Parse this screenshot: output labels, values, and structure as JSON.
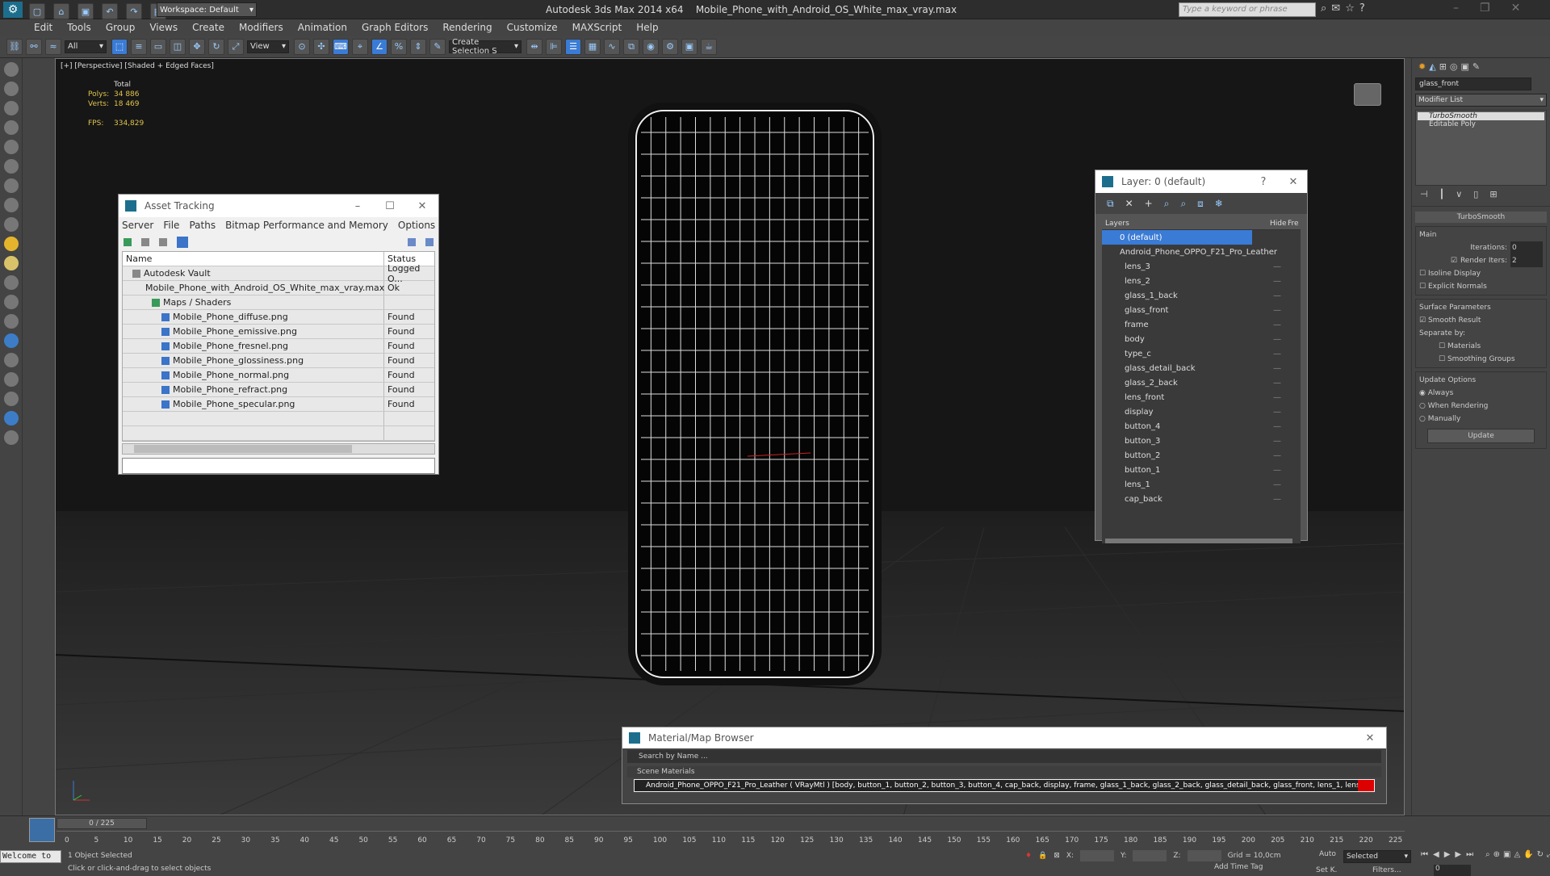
{
  "app": {
    "title": "Autodesk 3ds Max  2014 x64",
    "file": "Mobile_Phone_with_Android_OS_White_max_vray.max",
    "workspace": "Workspace: Default",
    "search_placeholder": "Type a keyword or phrase"
  },
  "menu": [
    "Edit",
    "Tools",
    "Group",
    "Views",
    "Create",
    "Modifiers",
    "Animation",
    "Graph Editors",
    "Rendering",
    "Customize",
    "MAXScript",
    "Help"
  ],
  "toolbar": {
    "filter": "All",
    "view": "View",
    "selection_set": "Create Selection S"
  },
  "viewport": {
    "label": "[+] [Perspective] [Shaded + Edged Faces]",
    "stats": {
      "total_label": "Total",
      "polys_label": "Polys:",
      "polys": "34 886",
      "verts_label": "Verts:",
      "verts": "18 469",
      "fps_label": "FPS:",
      "fps": "334,829"
    }
  },
  "asset_tracking": {
    "title": "Asset Tracking",
    "menu": [
      "Server",
      "File",
      "Paths",
      "Bitmap Performance and Memory",
      "Options"
    ],
    "columns": [
      "Name",
      "Status"
    ],
    "rows": [
      {
        "name": "Autodesk Vault",
        "status": "Logged O...",
        "indent": 1
      },
      {
        "name": "Mobile_Phone_with_Android_OS_White_max_vray.max",
        "status": "Ok",
        "indent": 2
      },
      {
        "name": "Maps / Shaders",
        "status": "",
        "indent": 3
      },
      {
        "name": "Mobile_Phone_diffuse.png",
        "status": "Found",
        "indent": 4
      },
      {
        "name": "Mobile_Phone_emissive.png",
        "status": "Found",
        "indent": 4
      },
      {
        "name": "Mobile_Phone_fresnel.png",
        "status": "Found",
        "indent": 4
      },
      {
        "name": "Mobile_Phone_glossiness.png",
        "status": "Found",
        "indent": 4
      },
      {
        "name": "Mobile_Phone_normal.png",
        "status": "Found",
        "indent": 4
      },
      {
        "name": "Mobile_Phone_refract.png",
        "status": "Found",
        "indent": 4
      },
      {
        "name": "Mobile_Phone_specular.png",
        "status": "Found",
        "indent": 4
      }
    ]
  },
  "layer": {
    "title": "Layer: 0 (default)",
    "columns": {
      "layers": "Layers",
      "hide": "Hide",
      "freeze": "Fre"
    },
    "default_layer": "0 (default)",
    "parent": "Android_Phone_OPPO_F21_Pro_Leather",
    "items": [
      "lens_3",
      "lens_2",
      "glass_1_back",
      "glass_front",
      "frame",
      "body",
      "type_c",
      "glass_detail_back",
      "glass_2_back",
      "lens_front",
      "display",
      "button_4",
      "button_3",
      "button_2",
      "button_1",
      "lens_1",
      "cap_back"
    ]
  },
  "material_browser": {
    "title": "Material/Map Browser",
    "search": "Search by Name ...",
    "section": "Scene Materials",
    "material": "Android_Phone_OPPO_F21_Pro_Leather ( VRayMtl ) [body, button_1, button_2, button_3, button_4, cap_back, display, frame, glass_1_back, glass_2_back, glass_detail_back, glass_front, lens_1, lens_2, lens_3, lens_front, type_c]"
  },
  "command_panel": {
    "object_name": "glass_front",
    "modifier_list": "Modifier List",
    "stack": [
      "TurboSmooth",
      "Editable Poly"
    ],
    "rollout": "TurboSmooth",
    "main": "Main",
    "iterations_label": "Iterations:",
    "iterations": "0",
    "render_iters_label": "Render Iters:",
    "render_iters": "2",
    "isoline": "Isoline Display",
    "explicit": "Explicit Normals",
    "surface": "Surface Parameters",
    "smooth_result": "Smooth Result",
    "separate": "Separate by:",
    "materials": "Materials",
    "smoothing": "Smoothing Groups",
    "update_options": "Update Options",
    "always": "Always",
    "when_rendering": "When Rendering",
    "manually": "Manually",
    "update": "Update"
  },
  "timeline": {
    "frame": "0 / 225",
    "ticks": [
      "0",
      "5",
      "10",
      "15",
      "20",
      "25",
      "30",
      "35",
      "40",
      "45",
      "50",
      "55",
      "60",
      "65",
      "70",
      "75",
      "80",
      "85",
      "90",
      "95",
      "100",
      "105",
      "110",
      "115",
      "120",
      "125",
      "130",
      "135",
      "140",
      "145",
      "150",
      "155",
      "160",
      "165",
      "170",
      "175",
      "180",
      "185",
      "190",
      "195",
      "200",
      "205",
      "210",
      "215",
      "220",
      "225"
    ]
  },
  "status": {
    "welcome": "Welcome to",
    "selected": "1 Object Selected",
    "prompt": "Click or click-and-drag to select objects",
    "x": "X:",
    "y": "Y:",
    "z": "Z:",
    "grid": "Grid = 10,0cm",
    "auto": "Auto",
    "selected_dd": "Selected",
    "set_key": "Set K.",
    "filters": "Filters...",
    "add_time_tag": "Add Time Tag",
    "frame_val": "0"
  }
}
